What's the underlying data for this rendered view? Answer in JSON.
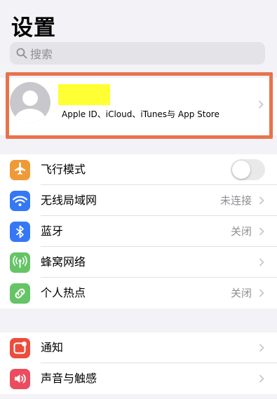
{
  "page": {
    "title": "设置"
  },
  "search": {
    "placeholder": "搜索"
  },
  "account": {
    "subtitle": "Apple ID、iCloud、iTunes与 App Store"
  },
  "connectivity": [
    {
      "label": "飞行模式",
      "value": "",
      "icon": "airplane-icon",
      "color": "#f09a37",
      "control": "toggle",
      "toggle_on": false
    },
    {
      "label": "无线局域网",
      "value": "未连接",
      "icon": "wifi-icon",
      "color": "#3478f6",
      "control": "chevron"
    },
    {
      "label": "蓝牙",
      "value": "关闭",
      "icon": "bluetooth-icon",
      "color": "#3478f6",
      "control": "chevron"
    },
    {
      "label": "蜂窝网络",
      "value": "",
      "icon": "cellular-icon",
      "color": "#65c466",
      "control": "chevron"
    },
    {
      "label": "个人热点",
      "value": "关闭",
      "icon": "hotspot-icon",
      "color": "#65c466",
      "control": "chevron"
    }
  ],
  "notifications": [
    {
      "label": "通知",
      "value": "",
      "icon": "notifications-icon",
      "color": "#eb4d3d",
      "control": "chevron"
    },
    {
      "label": "声音与触感",
      "value": "",
      "icon": "sounds-icon",
      "color": "#eb4d5f",
      "control": "chevron"
    }
  ]
}
